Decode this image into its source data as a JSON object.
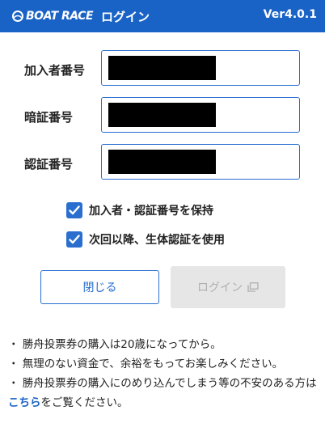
{
  "header": {
    "brand": "BOAT RACE",
    "title": "ログイン",
    "version": "Ver4.0.1",
    "color": "#1a63c6"
  },
  "fields": [
    {
      "label": "加入者番号",
      "value": "[redacted]"
    },
    {
      "label": "暗証番号",
      "value": "[redacted]"
    },
    {
      "label": "認証番号",
      "value": "[redacted]"
    }
  ],
  "checkboxes": [
    {
      "label": "加入者・認証番号を保持",
      "checked": true
    },
    {
      "label": "次回以降、生体認証を使用",
      "checked": true
    }
  ],
  "buttons": {
    "close": "閉じる",
    "login": "ログイン",
    "login_enabled": false
  },
  "notes": {
    "line1": "・ 勝舟投票券の購入は20歳になってから。",
    "line2": "・ 無理のない資金で、余裕をもってお楽しみください。",
    "line3_before": "・ 勝舟投票券の購入にのめり込んでしまう等の不安のある方は",
    "line3_link": "こちら",
    "line3_after": "をご覧ください。"
  },
  "colors": {
    "accent": "#2a6fd0",
    "disabled_bg": "#e6e6e6",
    "redaction": "#000000"
  }
}
